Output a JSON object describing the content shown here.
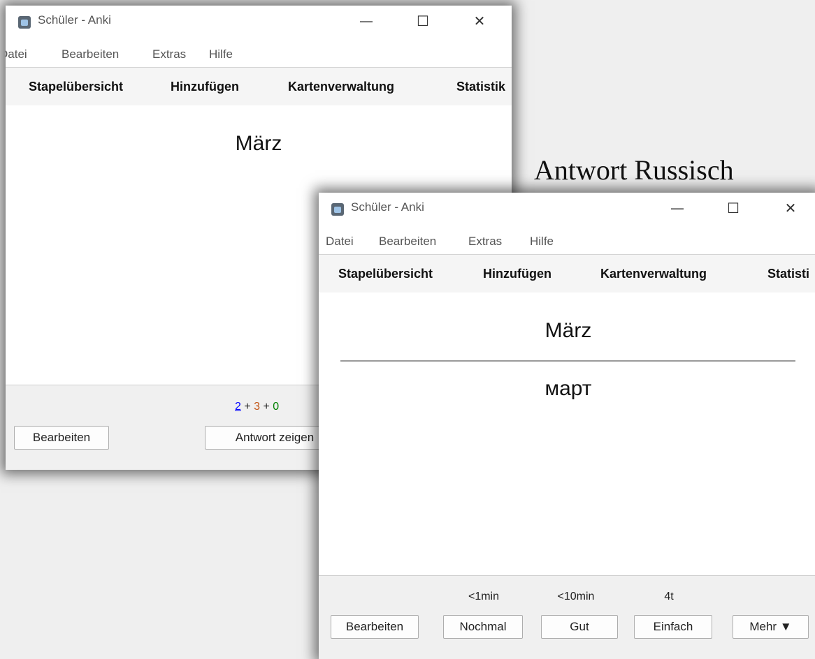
{
  "window_back": {
    "title": "Schüler - Anki",
    "controls": {
      "minimize": "—",
      "maximize": "☐",
      "close": "✕"
    },
    "menu": [
      "Datei",
      "Bearbeiten",
      "Extras",
      "Hilfe"
    ],
    "toolbar": [
      "Stapelübersicht",
      "Hinzufügen",
      "Kartenverwaltung",
      "Statistik"
    ],
    "card_front": "März",
    "counts": {
      "new": "2",
      "sep1": " + ",
      "learn": "3",
      "sep2": " + ",
      "review": "0"
    },
    "colors": {
      "new": "#0000ff",
      "learn": "#c35617",
      "review": "#008000"
    },
    "edit_button": "Bearbeiten",
    "show_answer_button": "Antwort zeigen"
  },
  "caption": "Antwort Russisch",
  "window_front": {
    "title": "Schüler - Anki",
    "controls": {
      "minimize": "—",
      "maximize": "☐",
      "close": "✕"
    },
    "menu": [
      "Datei",
      "Bearbeiten",
      "Extras",
      "Hilfe"
    ],
    "toolbar": [
      "Stapelübersicht",
      "Hinzufügen",
      "Kartenverwaltung",
      "Statisti"
    ],
    "card_front": "März",
    "card_back": "март",
    "intervals": [
      "<1min",
      "<10min",
      "4t"
    ],
    "edit_button": "Bearbeiten",
    "answer_buttons": [
      "Nochmal",
      "Gut",
      "Einfach"
    ],
    "more_button": "Mehr ▼"
  }
}
